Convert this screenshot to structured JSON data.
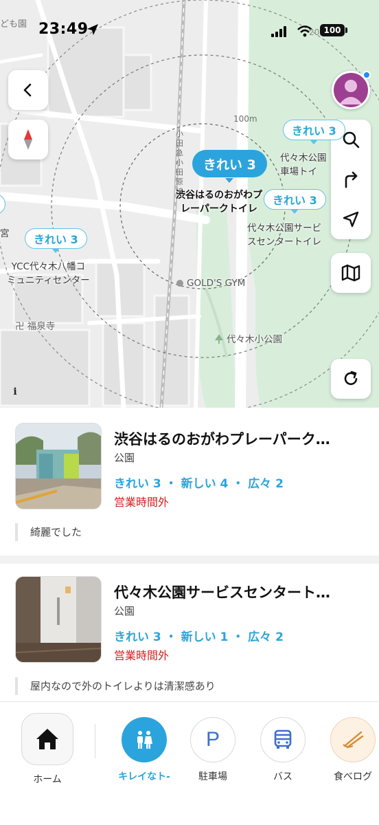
{
  "status_bar": {
    "time": "23:49",
    "battery": "100"
  },
  "map": {
    "corner_label": "ども園",
    "corner_right_label": "20",
    "scale_label": "100m",
    "vertical_line_label": "小田急小田原線",
    "pins": [
      {
        "id": "selected",
        "label": "きれい 3",
        "active": true
      },
      {
        "id": "ycc",
        "label": "きれい 3",
        "active": false
      },
      {
        "id": "yoyogi-service",
        "label": "きれい 3",
        "active": false
      },
      {
        "id": "yoyogi-parking",
        "label": "きれい 3",
        "active": false
      }
    ],
    "labels": {
      "selected_place": "渋谷はるのおがわプ\nレーパークトイレ",
      "ycc": "YCC代々木八幡コ\nミュニティセンター",
      "yoyogi_service": "代々木公園サービ\nスセンタートイレ",
      "yoyogi_parking": "代々木公園\n車場トイ",
      "golds_gym": "GOLD'S GYM",
      "fukusenji": "卍 福泉寺",
      "small_park": "代々木小公園",
      "miya": "宮"
    },
    "info_icon": "i",
    "buttons": {
      "back": "back-icon",
      "compass": "compass-icon",
      "search": "search-icon",
      "route": "turn-right-icon",
      "locate": "location-arrow-icon",
      "map_type": "map-icon",
      "refresh": "refresh-icon"
    }
  },
  "list": {
    "items": [
      {
        "title": "渋谷はるのおがわプレーパーク…",
        "category": "公園",
        "scores": "きれい 3 ・ 新しい 4 ・ 広々 2",
        "hours": "営業時間外",
        "comment": "綺麗でした"
      },
      {
        "title": "代々木公園サービスセンタート…",
        "category": "公園",
        "scores": "きれい 3 ・ 新しい 1 ・ 広々 2",
        "hours": "営業時間外",
        "comment": "屋内なので外のトイレよりは清潔感あり"
      }
    ]
  },
  "bottom_nav": {
    "home": "ホーム",
    "toilet": "キレイなト‐",
    "parking": "駐車場",
    "bus": "バス",
    "tabelog": "食べログ",
    "parking_glyph": "P"
  },
  "colors": {
    "accent": "#2ba4dd",
    "closed": "#d31f1f",
    "park_green": "#d9eedd"
  }
}
